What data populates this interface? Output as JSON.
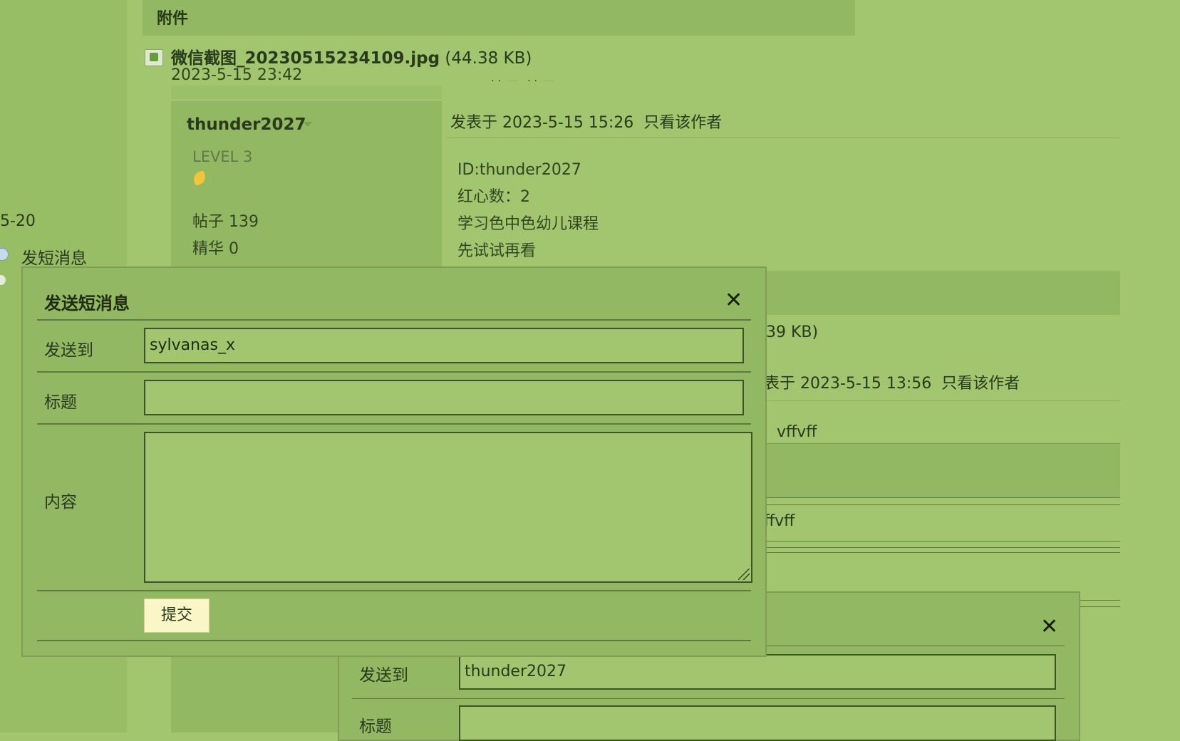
{
  "attachment": {
    "header": "附件",
    "file_name": "微信截图_20230515234109.jpg",
    "file_size": "(44.38 KB)",
    "file_date": "2023-5-15 23:42",
    "icon": "image-file-icon"
  },
  "user": {
    "name": "thunder2027",
    "level": "LEVEL 3",
    "level_icon": "moon-icon",
    "posts_label": "帖子",
    "posts_value": "139",
    "digest_label": "精华",
    "digest_value": "0"
  },
  "left_partial": {
    "date": "5-20",
    "send_message": "发短消息"
  },
  "post": {
    "posted": "发表于 2023-5-15 15:26",
    "only_author": "只看该作者",
    "lines": [
      "ID:thunder2027",
      "红心数：2",
      "学习色中色幼儿课程",
      "先试试再看"
    ]
  },
  "post2": {
    "size_fragment": ".39 KB)",
    "posted_fragment": "表于 2023-5-15 13:56",
    "only_author": "只看该作者",
    "reply_fragment_1": "：vffvff",
    "reply_fragment_2": "ffvff"
  },
  "dialog": {
    "title": "发送短消息",
    "to_label": "发送到",
    "to_value": "sylvanas_x",
    "subject_label": "标题",
    "subject_value": "",
    "content_label": "内容",
    "content_value": "",
    "submit_label": "提交"
  },
  "dialog2": {
    "to_label": "发送到",
    "to_value": "thunder2027",
    "subject_label": "标题"
  }
}
